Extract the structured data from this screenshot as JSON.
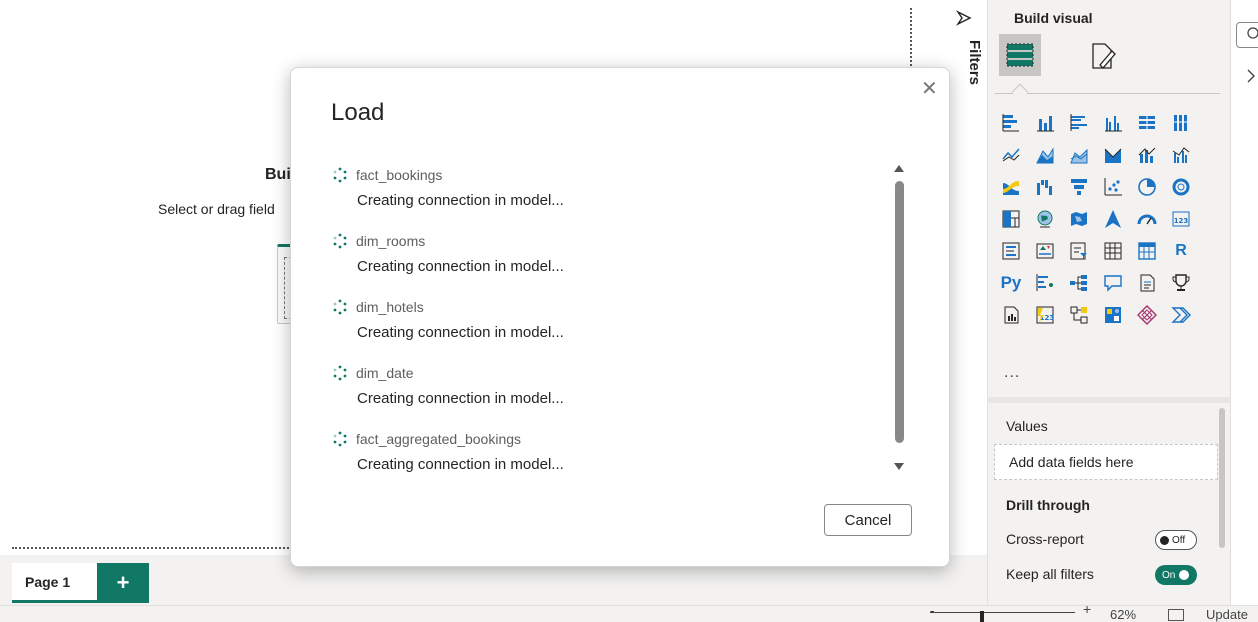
{
  "canvas": {
    "build_title": "Bui",
    "build_subtitle": "Select or drag field"
  },
  "pages": {
    "tab_label": "Page 1",
    "add_label": "+"
  },
  "status": {
    "zoom_minus": "-",
    "zoom_plus": "+",
    "zoom_level": "62%",
    "update_text": "Update"
  },
  "filters": {
    "label": "Filters"
  },
  "visualizations": {
    "title": "Build visual",
    "more": "...",
    "values_label": "Values",
    "values_placeholder": "Add data fields here",
    "drill_title": "Drill through",
    "cross_report_label": "Cross-report",
    "cross_report_state": "Off",
    "keep_filters_label": "Keep all filters",
    "keep_filters_state": "On",
    "text_glyph_r": "R",
    "text_glyph_py": "Py"
  },
  "modal": {
    "title": "Load",
    "close_glyph": "✕",
    "items": [
      {
        "name": "fact_bookings",
        "status": "Creating connection in model..."
      },
      {
        "name": "dim_rooms",
        "status": "Creating connection in model..."
      },
      {
        "name": "dim_hotels",
        "status": "Creating connection in model..."
      },
      {
        "name": "dim_date",
        "status": "Creating connection in model..."
      },
      {
        "name": "fact_aggregated_bookings",
        "status": "Creating connection in model..."
      }
    ],
    "cancel_label": "Cancel"
  },
  "colors": {
    "accent": "#117865",
    "visual_blue": "#1a73c4",
    "visual_teal": "#117865"
  }
}
